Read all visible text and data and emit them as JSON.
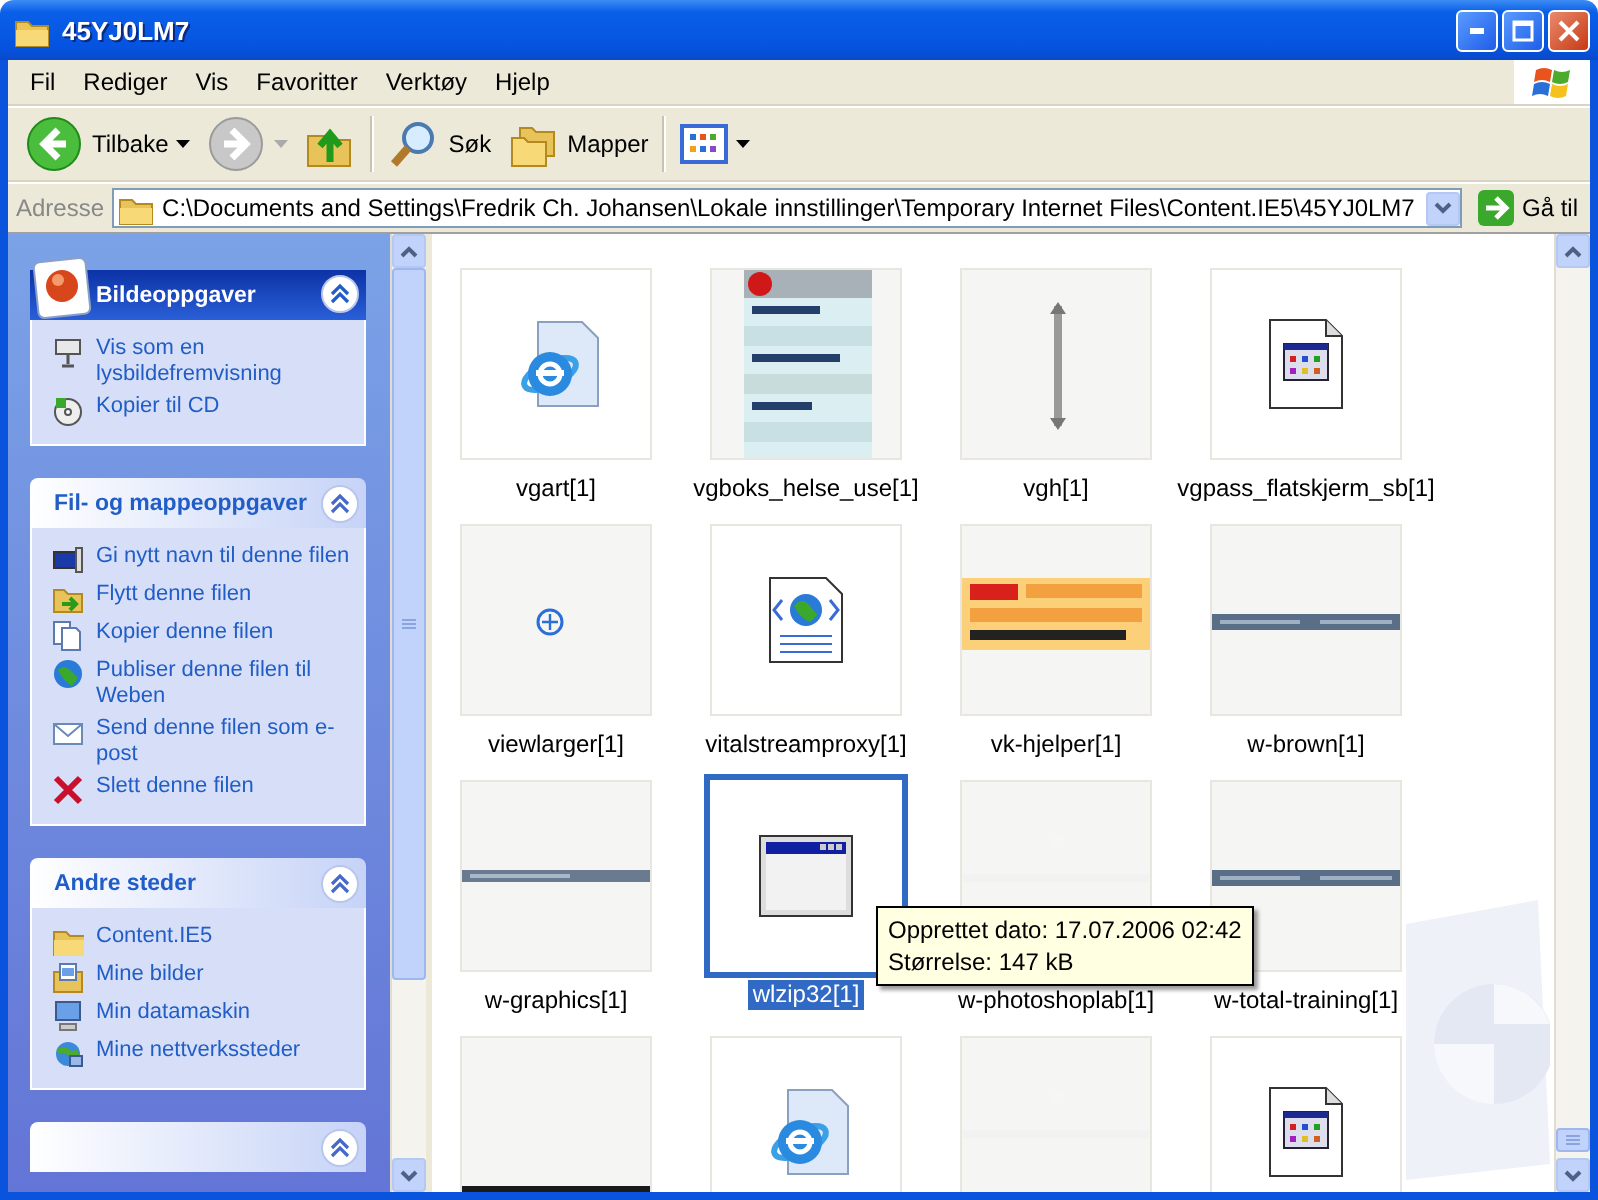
{
  "window": {
    "title": "45YJ0LM7"
  },
  "menu": [
    "Fil",
    "Rediger",
    "Vis",
    "Favoritter",
    "Verktøy",
    "Hjelp"
  ],
  "toolbar": [
    {
      "kind": "back",
      "label": "Tilbake",
      "disabled": false
    },
    {
      "kind": "forward",
      "disabled": true
    },
    {
      "kind": "up"
    },
    {
      "kind": "search",
      "label": "Søk"
    },
    {
      "kind": "folders",
      "label": "Mapper"
    },
    {
      "kind": "views"
    }
  ],
  "address": {
    "label": "Adresse",
    "value": "C:\\Documents and Settings\\Fredrik Ch. Johansen\\Lokale innstillinger\\Temporary Internet Files\\Content.IE5\\45YJ0LM7",
    "go": "Gå til"
  },
  "task_panes": [
    {
      "kind": "special",
      "title": "Bildeoppgaver",
      "expanded": true,
      "items": [
        "Vis som en lysbildefremvisning",
        "Kopier til CD"
      ]
    },
    {
      "kind": "normal",
      "title": "Fil- og mappeoppgaver",
      "expanded": true,
      "items": [
        "Gi nytt navn til denne filen",
        "Flytt denne filen",
        "Kopier denne filen",
        "Publiser denne filen til Weben",
        "Send denne filen som e-post",
        "Slett denne filen"
      ]
    },
    {
      "kind": "normal",
      "title": "Andre steder",
      "expanded": true,
      "items": [
        "Content.IE5",
        "Mine bilder",
        "Min datamaskin",
        "Mine nettverkssteder"
      ]
    },
    {
      "kind": "normal",
      "expanded": true
    }
  ],
  "files": [
    {
      "name": "vgart[1]",
      "kind": "ie",
      "selected": false
    },
    {
      "name": "vgboks_helse_use[1]",
      "kind": "picture",
      "selected": false
    },
    {
      "name": "vgh[1]",
      "kind": "picture",
      "selected": false
    },
    {
      "name": "vgpass_flatskjerm_sb[1]",
      "kind": "appdoc",
      "selected": false
    },
    {
      "name": "viewlarger[1]",
      "kind": "picture",
      "selected": false
    },
    {
      "name": "vitalstreamproxy[1]",
      "kind": "webdoc",
      "selected": false
    },
    {
      "name": "vk-hjelper[1]",
      "kind": "picture",
      "selected": false
    },
    {
      "name": "w-brown[1]",
      "kind": "picture",
      "selected": false
    },
    {
      "name": "w-graphics[1]",
      "kind": "picture",
      "selected": false
    },
    {
      "name": "wlzip32[1]",
      "kind": "app",
      "selected": true
    },
    {
      "name": "w-photoshoplab[1]",
      "kind": "picture",
      "selected": false
    },
    {
      "name": "w-total-training[1]",
      "kind": "picture",
      "selected": false
    },
    {
      "kind": "picture",
      "selected": false
    },
    {
      "kind": "ie",
      "selected": false
    },
    {
      "kind": "picture",
      "selected": false
    },
    {
      "kind": "appdoc",
      "selected": false
    }
  ],
  "tooltip": [
    "Opprettet dato: 17.07.2006 02:42",
    "Størrelse: 147 kB"
  ]
}
